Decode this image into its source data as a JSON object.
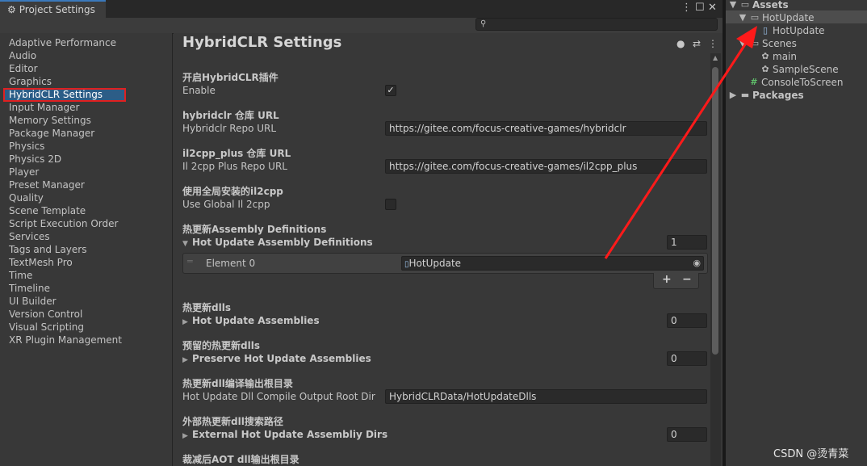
{
  "window": {
    "tab_label": "Project Settings",
    "tab_icon": "gear-icon",
    "search": {
      "placeholder": "",
      "value": ""
    }
  },
  "sidebar": {
    "items": [
      "Adaptive Performance",
      "Audio",
      "Editor",
      "Graphics",
      "HybridCLR Settings",
      "Input Manager",
      "Memory Settings",
      "Package Manager",
      "Physics",
      "Physics 2D",
      "Player",
      "Preset Manager",
      "Quality",
      "Scene Template",
      "Script Execution Order",
      "Services",
      "Tags and Layers",
      "TextMesh Pro",
      "Time",
      "Timeline",
      "UI Builder",
      "Version Control",
      "Visual Scripting",
      "XR Plugin Management"
    ],
    "selected": "HybridCLR Settings"
  },
  "main": {
    "title": "HybridCLR Settings",
    "enable": {
      "section": "开启HybridCLR插件",
      "label": "Enable",
      "checked": true
    },
    "repo_url": {
      "section": "hybridclr 仓库 URL",
      "label": "Hybridclr Repo URL",
      "value": "https://gitee.com/focus-creative-games/hybridclr"
    },
    "il2cpp_url": {
      "section": "il2cpp_plus 仓库 URL",
      "label": "Il 2cpp Plus Repo URL",
      "value": "https://gitee.com/focus-creative-games/il2cpp_plus"
    },
    "global_il2cpp": {
      "section": "使用全局安装的il2cpp",
      "label": "Use Global Il 2cpp",
      "checked": false
    },
    "asm_defs": {
      "section": "热更新Assembly Definitions",
      "label": "Hot Update Assembly Definitions",
      "count": "1",
      "element_label": "Element 0",
      "element_value": "HotUpdate",
      "add": "+",
      "remove": "−"
    },
    "hot_dlls": {
      "section": "热更新dlls",
      "label": "Hot Update Assemblies",
      "count": "0"
    },
    "preserve": {
      "section": "预留的热更新dlls",
      "label": "Preserve Hot Update Assemblies",
      "count": "0"
    },
    "output_dir": {
      "section": "热更新dll编译输出根目录",
      "label": "Hot Update Dll Compile Output Root Dir",
      "value": "HybridCLRData/HotUpdateDlls"
    },
    "external_dirs": {
      "section": "外部热更新dll搜索路径",
      "label": "External Hot Update Assembliy Dirs",
      "count": "0"
    },
    "aot_dir": {
      "section": "裁减后AOT dll输出根目录"
    }
  },
  "project_tree": {
    "assets": "Assets",
    "hotupdate_folder": "HotUpdate",
    "hotupdate_asmdef": "HotUpdate",
    "scenes": "Scenes",
    "scene_main": "main",
    "scene_sample": "SampleScene",
    "console_script": "ConsoleToScreen",
    "packages": "Packages"
  },
  "watermark": "CSDN @烫青菜",
  "colors": {
    "accent": "#3a79bb",
    "selection_outline": "#e02020",
    "arrow": "#ff1a1a"
  }
}
